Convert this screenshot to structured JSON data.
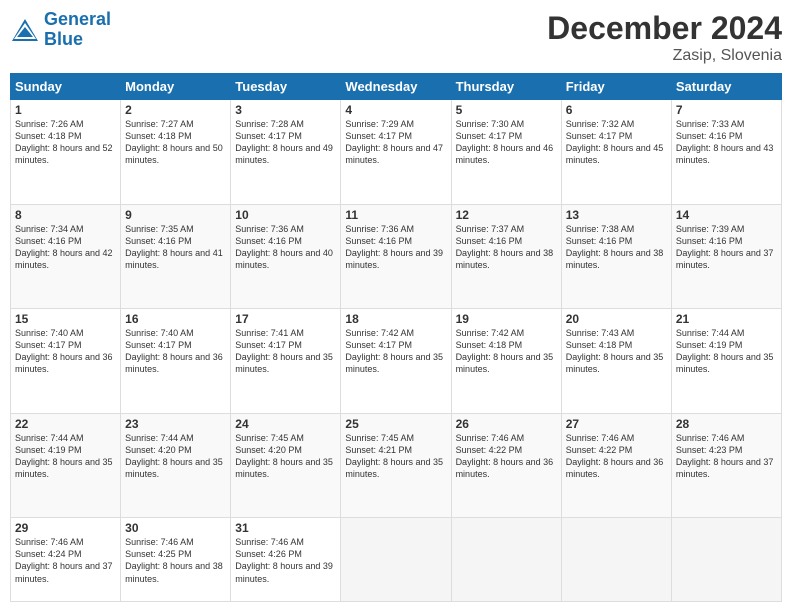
{
  "logo": {
    "line1": "General",
    "line2": "Blue"
  },
  "title": "December 2024",
  "subtitle": "Zasip, Slovenia",
  "days_header": [
    "Sunday",
    "Monday",
    "Tuesday",
    "Wednesday",
    "Thursday",
    "Friday",
    "Saturday"
  ],
  "weeks": [
    [
      {
        "num": "1",
        "sunrise": "Sunrise: 7:26 AM",
        "sunset": "Sunset: 4:18 PM",
        "daylight": "Daylight: 8 hours and 52 minutes."
      },
      {
        "num": "2",
        "sunrise": "Sunrise: 7:27 AM",
        "sunset": "Sunset: 4:18 PM",
        "daylight": "Daylight: 8 hours and 50 minutes."
      },
      {
        "num": "3",
        "sunrise": "Sunrise: 7:28 AM",
        "sunset": "Sunset: 4:17 PM",
        "daylight": "Daylight: 8 hours and 49 minutes."
      },
      {
        "num": "4",
        "sunrise": "Sunrise: 7:29 AM",
        "sunset": "Sunset: 4:17 PM",
        "daylight": "Daylight: 8 hours and 47 minutes."
      },
      {
        "num": "5",
        "sunrise": "Sunrise: 7:30 AM",
        "sunset": "Sunset: 4:17 PM",
        "daylight": "Daylight: 8 hours and 46 minutes."
      },
      {
        "num": "6",
        "sunrise": "Sunrise: 7:32 AM",
        "sunset": "Sunset: 4:17 PM",
        "daylight": "Daylight: 8 hours and 45 minutes."
      },
      {
        "num": "7",
        "sunrise": "Sunrise: 7:33 AM",
        "sunset": "Sunset: 4:16 PM",
        "daylight": "Daylight: 8 hours and 43 minutes."
      }
    ],
    [
      {
        "num": "8",
        "sunrise": "Sunrise: 7:34 AM",
        "sunset": "Sunset: 4:16 PM",
        "daylight": "Daylight: 8 hours and 42 minutes."
      },
      {
        "num": "9",
        "sunrise": "Sunrise: 7:35 AM",
        "sunset": "Sunset: 4:16 PM",
        "daylight": "Daylight: 8 hours and 41 minutes."
      },
      {
        "num": "10",
        "sunrise": "Sunrise: 7:36 AM",
        "sunset": "Sunset: 4:16 PM",
        "daylight": "Daylight: 8 hours and 40 minutes."
      },
      {
        "num": "11",
        "sunrise": "Sunrise: 7:36 AM",
        "sunset": "Sunset: 4:16 PM",
        "daylight": "Daylight: 8 hours and 39 minutes."
      },
      {
        "num": "12",
        "sunrise": "Sunrise: 7:37 AM",
        "sunset": "Sunset: 4:16 PM",
        "daylight": "Daylight: 8 hours and 38 minutes."
      },
      {
        "num": "13",
        "sunrise": "Sunrise: 7:38 AM",
        "sunset": "Sunset: 4:16 PM",
        "daylight": "Daylight: 8 hours and 38 minutes."
      },
      {
        "num": "14",
        "sunrise": "Sunrise: 7:39 AM",
        "sunset": "Sunset: 4:16 PM",
        "daylight": "Daylight: 8 hours and 37 minutes."
      }
    ],
    [
      {
        "num": "15",
        "sunrise": "Sunrise: 7:40 AM",
        "sunset": "Sunset: 4:17 PM",
        "daylight": "Daylight: 8 hours and 36 minutes."
      },
      {
        "num": "16",
        "sunrise": "Sunrise: 7:40 AM",
        "sunset": "Sunset: 4:17 PM",
        "daylight": "Daylight: 8 hours and 36 minutes."
      },
      {
        "num": "17",
        "sunrise": "Sunrise: 7:41 AM",
        "sunset": "Sunset: 4:17 PM",
        "daylight": "Daylight: 8 hours and 35 minutes."
      },
      {
        "num": "18",
        "sunrise": "Sunrise: 7:42 AM",
        "sunset": "Sunset: 4:17 PM",
        "daylight": "Daylight: 8 hours and 35 minutes."
      },
      {
        "num": "19",
        "sunrise": "Sunrise: 7:42 AM",
        "sunset": "Sunset: 4:18 PM",
        "daylight": "Daylight: 8 hours and 35 minutes."
      },
      {
        "num": "20",
        "sunrise": "Sunrise: 7:43 AM",
        "sunset": "Sunset: 4:18 PM",
        "daylight": "Daylight: 8 hours and 35 minutes."
      },
      {
        "num": "21",
        "sunrise": "Sunrise: 7:44 AM",
        "sunset": "Sunset: 4:19 PM",
        "daylight": "Daylight: 8 hours and 35 minutes."
      }
    ],
    [
      {
        "num": "22",
        "sunrise": "Sunrise: 7:44 AM",
        "sunset": "Sunset: 4:19 PM",
        "daylight": "Daylight: 8 hours and 35 minutes."
      },
      {
        "num": "23",
        "sunrise": "Sunrise: 7:44 AM",
        "sunset": "Sunset: 4:20 PM",
        "daylight": "Daylight: 8 hours and 35 minutes."
      },
      {
        "num": "24",
        "sunrise": "Sunrise: 7:45 AM",
        "sunset": "Sunset: 4:20 PM",
        "daylight": "Daylight: 8 hours and 35 minutes."
      },
      {
        "num": "25",
        "sunrise": "Sunrise: 7:45 AM",
        "sunset": "Sunset: 4:21 PM",
        "daylight": "Daylight: 8 hours and 35 minutes."
      },
      {
        "num": "26",
        "sunrise": "Sunrise: 7:46 AM",
        "sunset": "Sunset: 4:22 PM",
        "daylight": "Daylight: 8 hours and 36 minutes."
      },
      {
        "num": "27",
        "sunrise": "Sunrise: 7:46 AM",
        "sunset": "Sunset: 4:22 PM",
        "daylight": "Daylight: 8 hours and 36 minutes."
      },
      {
        "num": "28",
        "sunrise": "Sunrise: 7:46 AM",
        "sunset": "Sunset: 4:23 PM",
        "daylight": "Daylight: 8 hours and 37 minutes."
      }
    ],
    [
      {
        "num": "29",
        "sunrise": "Sunrise: 7:46 AM",
        "sunset": "Sunset: 4:24 PM",
        "daylight": "Daylight: 8 hours and 37 minutes."
      },
      {
        "num": "30",
        "sunrise": "Sunrise: 7:46 AM",
        "sunset": "Sunset: 4:25 PM",
        "daylight": "Daylight: 8 hours and 38 minutes."
      },
      {
        "num": "31",
        "sunrise": "Sunrise: 7:46 AM",
        "sunset": "Sunset: 4:26 PM",
        "daylight": "Daylight: 8 hours and 39 minutes."
      },
      null,
      null,
      null,
      null
    ]
  ]
}
